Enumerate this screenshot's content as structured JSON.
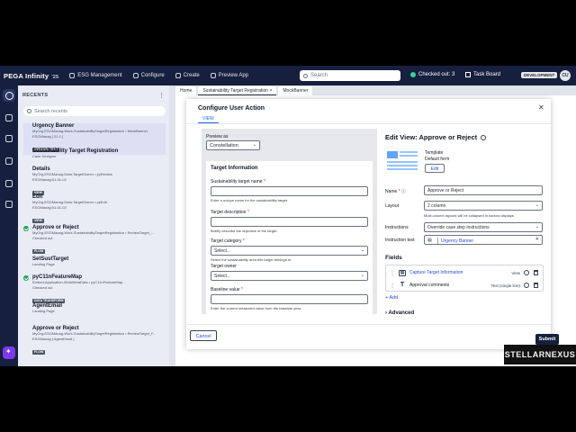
{
  "topbar": {
    "brand": "PEGA Infinity",
    "version": "'25",
    "nav": [
      {
        "label": "ESG Management",
        "icon": "app-icon"
      },
      {
        "label": "Configure",
        "icon": "configure-icon"
      },
      {
        "label": "Create",
        "icon": "plus-icon"
      },
      {
        "label": "Preview App",
        "icon": "preview-icon"
      }
    ],
    "search_placeholder": "Search",
    "checked_out": "Checked out: 3",
    "task_board": "Task Board",
    "environment": "DEVELOPMENT",
    "user_initials": "CU"
  },
  "recents": {
    "heading": "RECENTS",
    "search_placeholder": "Search recents",
    "items": [
      {
        "title": "Urgency Banner",
        "sub": "MyOrg-ESGManag-Work-SustainabilityTargetRegistration • MockBanner",
        "sub2": "ESGManag [ 01-1 ]",
        "badge": "DYNAMIC TEXT",
        "checked": false,
        "highlight": true
      },
      {
        "title": "Sustainability Target Registration",
        "sub": "Case Designer",
        "sub2": "",
        "badge": "",
        "checked": false,
        "highlight": false
      },
      {
        "title": "Details",
        "sub": "MyOrg-ESGManag-Data-TargetOwner • pyReview",
        "sub2": "ESGManag:01-01-02",
        "badge": "VIEW",
        "checked": false,
        "highlight": false
      },
      {
        "title": "Edit",
        "sub": "MyOrg-ESGManag-Data-TargetOwner • pyEdit",
        "sub2": "ESGManag:01-01-02",
        "badge": "VIEW",
        "checked": false,
        "highlight": false
      },
      {
        "title": "Approve or Reject",
        "sub": "MyOrg-ESGManag-Work-SustainabilityTargetRegistration • ReviewTarget_...",
        "sub2": "Checked out",
        "badge": "FLOW",
        "checked": true,
        "highlight": false
      },
      {
        "title": "SetSustTarget",
        "sub": "Landing Page",
        "sub2": "",
        "badge": "",
        "checked": false,
        "highlight": false
      },
      {
        "title": "pyC11nFeatureMap",
        "sub": "Embed-Application-WorkMetaData • pyC11nFeatureMap",
        "sub2": "Checked out",
        "badge": "DATA TRANSFORM",
        "checked": true,
        "highlight": false
      },
      {
        "title": "AgentEmail",
        "sub": "Landing Page",
        "sub2": "",
        "badge": "",
        "checked": false,
        "highlight": false
      },
      {
        "title": "Approve or Reject",
        "sub": "MyOrg-ESGManag-Work-SustainabilityTargetRegistration • ReviewTarget_F...",
        "sub2": "ESGManag [ AgentEmail ]",
        "badge": "FLOW",
        "checked": false,
        "highlight": false
      }
    ]
  },
  "tabs": [
    "Home",
    "Sustainability Target Registration",
    "MockBanner"
  ],
  "modal": {
    "title": "Configure User Action",
    "view_tab": "VIEW",
    "preview_label": "Preview as",
    "preview_value": "Constellation",
    "form_heading": "Target Information",
    "form_fields": [
      {
        "label": "Sustainability target name",
        "required": true,
        "value": "",
        "help": "Enter a unique name for the sustainability target.",
        "dropdown": false
      },
      {
        "label": "Target description",
        "required": true,
        "value": "",
        "help": "Briefly describe the objective of the target.",
        "dropdown": false
      },
      {
        "label": "Target category",
        "required": true,
        "value": "Select...",
        "help": "Select the sustainability area this target belongs to.",
        "dropdown": true
      },
      {
        "label": "Target owner",
        "required": false,
        "value": "Select...",
        "help": "",
        "dropdown": true
      },
      {
        "label": "Baseline value",
        "required": true,
        "value": "",
        "help": "Enter the current measured value from the baseline year.",
        "dropdown": false
      }
    ],
    "edit_title": "Edit View: Approve or Reject",
    "template_label": "Template",
    "template_value": "Default form",
    "edit_button": "Edit",
    "name_label": "Name",
    "name_value": "Approve or Reject",
    "layout_label": "Layout",
    "layout_value": "2 column",
    "layout_help": "Multi-column layouts will be collapsed in narrow displays",
    "instructions_label": "Instructions",
    "instructions_value": "Override case step instructions",
    "instruction_text_label": "Instruction text",
    "instruction_text_value": "Urgency Banner",
    "fields_heading": "Fields",
    "fields": [
      {
        "name": "Capture Target Information",
        "type": "View",
        "link": true
      },
      {
        "name": "Approval comments",
        "type": "Text (single line)",
        "link": false
      }
    ],
    "add_label": "+ Add",
    "advanced_label": "Advanced",
    "cancel_label": "Cancel",
    "submit_label": "Submit"
  },
  "watermark": "STELLARNEXUS"
}
